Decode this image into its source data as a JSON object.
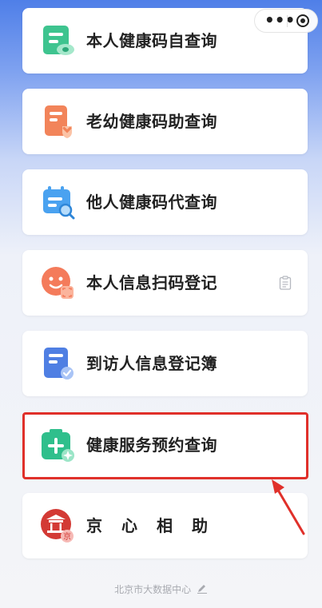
{
  "capsule": {
    "more_icon": "more-dots-icon",
    "close_icon": "target-icon"
  },
  "menu": {
    "items": [
      {
        "label": "本人健康码自查询",
        "icon": "green-card-icon"
      },
      {
        "label": "老幼健康码助查询",
        "icon": "orange-card-icon"
      },
      {
        "label": "他人健康码代查询",
        "icon": "blue-card-search-icon"
      },
      {
        "label": "本人信息扫码登记",
        "icon": "smile-scan-icon",
        "trail_icon": "clipboard-icon"
      },
      {
        "label": "到访人信息登记簿",
        "icon": "blue-check-doc-icon"
      },
      {
        "label": "健康服务预约查询",
        "icon": "green-plus-icon"
      },
      {
        "label": "京心相助",
        "icon": "jing-emblem-icon",
        "badge": "京"
      }
    ]
  },
  "footer": {
    "text": "北京市大数据中心"
  },
  "annotation": {
    "highlight_color": "#e0302a"
  }
}
